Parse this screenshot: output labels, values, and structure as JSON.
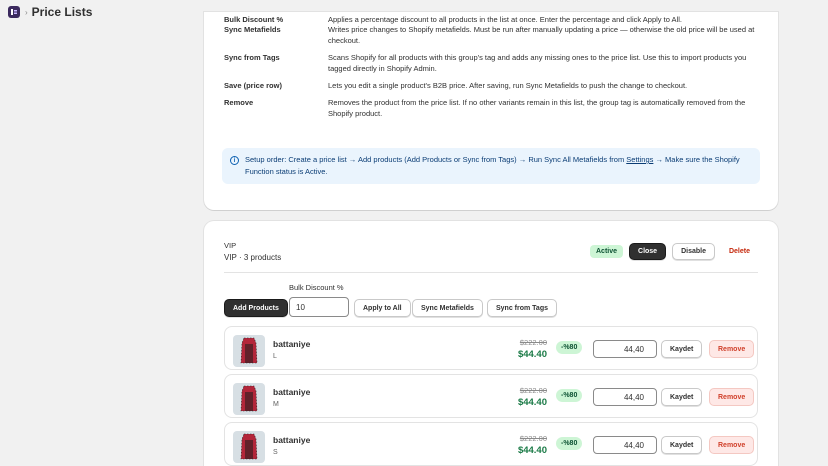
{
  "header": {
    "separator": "›",
    "title": "Price Lists"
  },
  "help": {
    "partial_row": {
      "key": "Bulk Discount %",
      "desc": "Applies a percentage discount to all products in the list at once. Enter the percentage and click Apply to All."
    },
    "rows": [
      {
        "key": "Sync Metafields",
        "desc": "Writes price changes to Shopify metafields. Must be run after manually updating a price — otherwise the old price will be used at checkout."
      },
      {
        "key": "Sync from Tags",
        "desc": "Scans Shopify for all products with this group's tag and adds any missing ones to the price list. Use this to import products you tagged directly in Shopify Admin."
      },
      {
        "key": "Save (price row)",
        "desc": "Lets you edit a single product's B2B price. After saving, run Sync Metafields to push the change to checkout."
      },
      {
        "key": "Remove",
        "desc": "Removes the product from the price list. If no other variants remain in this list, the group tag is automatically removed from the Shopify product."
      }
    ],
    "banner": {
      "text_before": "Setup order: Create a price list → Add products (Add Products or Sync from Tags) → Run Sync All Metafields from ",
      "link": "Settings",
      "text_after": " → Make sure the Shopify Function status is Active."
    }
  },
  "group": {
    "name": "VIP",
    "count_line": "VIP · 3 products",
    "status": "Active",
    "close_label": "Close",
    "disable_label": "Disable",
    "delete_label": "Delete",
    "add_products_label": "Add Products",
    "bulk_label": "Bulk Discount %",
    "bulk_value": "10",
    "apply_all_label": "Apply to All",
    "sync_metafields_label": "Sync Metafields",
    "sync_tags_label": "Sync from Tags"
  },
  "products": [
    {
      "name": "battaniye",
      "variant": "L",
      "old_price": "$222.00",
      "new_price": "$44.40",
      "discount": "-%80",
      "price_value": "44,40",
      "save_label": "Kaydet",
      "remove_label": "Remove"
    },
    {
      "name": "battaniye",
      "variant": "M",
      "old_price": "$222.00",
      "new_price": "$44.40",
      "discount": "-%80",
      "price_value": "44,40",
      "save_label": "Kaydet",
      "remove_label": "Remove"
    },
    {
      "name": "battaniye",
      "variant": "S",
      "old_price": "$222.00",
      "new_price": "$44.40",
      "discount": "-%80",
      "price_value": "44,40",
      "save_label": "Kaydet",
      "remove_label": "Remove"
    }
  ],
  "colors": {
    "active_bg": "#cdf5d5",
    "price_green": "#1a7a46",
    "remove_red": "#d0402b",
    "banner_bg": "#eaf4fd"
  }
}
